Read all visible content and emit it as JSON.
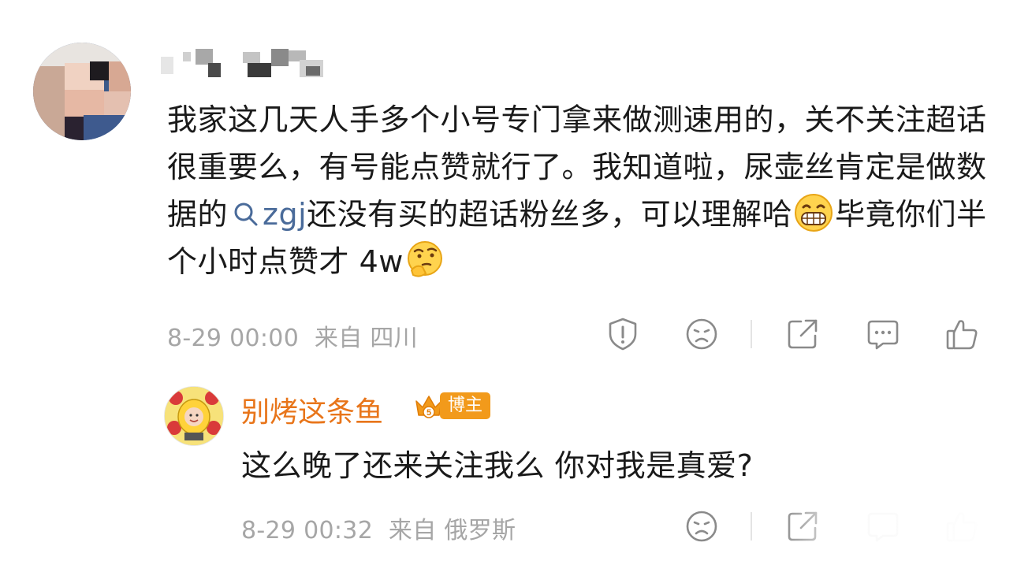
{
  "comment": {
    "text_part1": "我家这几天人手多个小号专门拿来做测速用的，关不关注超话很重要么，有号能点赞就行了。我知道啦，尿壶丝肯定是做数据的",
    "topic_link": "zgj",
    "text_part2": "还没有买的超话粉丝多，可以理解哈",
    "text_part3": "毕竟你们半个小时点赞才 4w",
    "emoji_1": "grin-emoji",
    "emoji_2": "thinking-emoji",
    "timestamp": "8-29 00:00",
    "location": "来自 四川",
    "actions": [
      "report-icon",
      "dislike-icon",
      "share-icon",
      "comment-icon",
      "like-icon"
    ]
  },
  "reply": {
    "author": "别烤这条鱼",
    "badge_label": "博主",
    "text": "这么晚了还来关注我么 你对我是真爱?",
    "timestamp": "8-29 00:32",
    "location": "来自 俄罗斯",
    "actions": [
      "dislike-icon",
      "share-icon",
      "comment-icon",
      "like-icon"
    ]
  },
  "colors": {
    "text": "#1a1a1a",
    "meta": "#a6a6a6",
    "link": "#4a6b9a",
    "author": "#e8751a",
    "badge": "#f29a1b"
  }
}
